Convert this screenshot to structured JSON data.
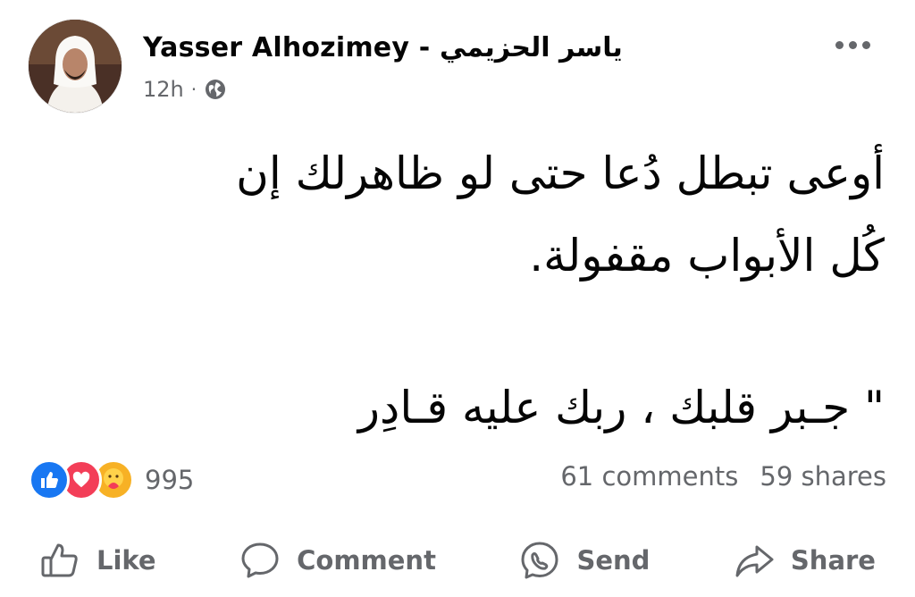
{
  "post": {
    "author": "Yasser Alhozimey - ياسر الحزيمي",
    "time": "12h",
    "separator": "·",
    "privacy_icon": "globe-icon",
    "text_line1": "أوعى تبطل دُعا حتى لو ظاهرلك إن",
    "text_line2": "كُل الأبواب مقفولة.",
    "text_line3": "\" جـبر قلبك ، ربك عليه قـادِر"
  },
  "stats": {
    "reaction_count": "995",
    "comments": "61 comments",
    "shares": "59 shares",
    "reaction_icons": [
      "like-icon",
      "love-icon",
      "care-icon"
    ]
  },
  "actions": {
    "like": "Like",
    "comment": "Comment",
    "send": "Send",
    "share": "Share"
  },
  "colors": {
    "like_blue": "#1877f2",
    "love_red": "#f33e58",
    "care_yellow": "#f7b125",
    "secondary_text": "#65676b"
  }
}
